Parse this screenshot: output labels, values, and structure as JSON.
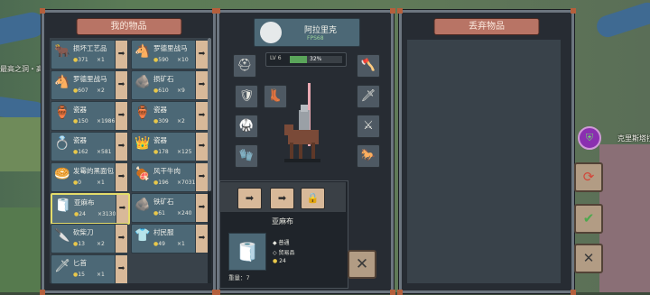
{
  "map": {
    "labels": {
      "left_town": "最高之洞・高村",
      "right_town": "克里斯塔拉"
    }
  },
  "left_panel": {
    "title": "我的物品",
    "items": [
      {
        "name": "损坏工艺品",
        "price": "371",
        "qty": "×1",
        "icon": "tools-icon",
        "glyph": "🐂"
      },
      {
        "name": "罗德里战马",
        "price": "590",
        "qty": "×10",
        "icon": "horse-icon",
        "glyph": "🐴"
      },
      {
        "name": "罗德里战马",
        "price": "607",
        "qty": "×2",
        "icon": "horse-icon",
        "glyph": "🐴"
      },
      {
        "name": "损矿石",
        "price": "610",
        "qty": "×9",
        "icon": "ore-icon",
        "glyph": "🪨"
      },
      {
        "name": "瓷器",
        "price": "150",
        "qty": "×1986",
        "icon": "pottery-icon",
        "glyph": "🏺"
      },
      {
        "name": "瓷器",
        "price": "309",
        "qty": "×2",
        "icon": "pottery-icon",
        "glyph": "🏺"
      },
      {
        "name": "瓷器",
        "price": "162",
        "qty": "×581",
        "icon": "jewelry-icon",
        "glyph": "💍"
      },
      {
        "name": "瓷器",
        "price": "178",
        "qty": "×125",
        "icon": "jewelry-icon",
        "glyph": "👑"
      },
      {
        "name": "发霉的黑面包",
        "price": "0",
        "qty": "×1",
        "icon": "bread-icon",
        "glyph": "🥯"
      },
      {
        "name": "风干牛肉",
        "price": "196",
        "qty": "×7031",
        "icon": "meat-icon",
        "glyph": "🍖"
      },
      {
        "name": "亚麻布",
        "price": "24",
        "qty": "×3130",
        "icon": "linen-icon",
        "glyph": "🧻",
        "selected": true
      },
      {
        "name": "铁矿石",
        "price": "61",
        "qty": "×240",
        "icon": "iron-ore-icon",
        "glyph": "🪨"
      },
      {
        "name": "砍柴刀",
        "price": "13",
        "qty": "×2",
        "icon": "machete-icon",
        "glyph": "🔪"
      },
      {
        "name": "村民服",
        "price": "49",
        "qty": "×1",
        "icon": "clothes-icon",
        "glyph": "👕"
      },
      {
        "name": "匕首",
        "price": "15",
        "qty": "×1",
        "icon": "dagger-icon",
        "glyph": "🗡"
      }
    ]
  },
  "character": {
    "name": "阿拉里克",
    "subtitle": "FPS68",
    "level_label": "LV 6",
    "xp_percent_text": "32%",
    "xp_fraction": 0.32
  },
  "selected_item": {
    "name": "亚麻布",
    "quality": "普通",
    "category": "贸易品",
    "price": "24",
    "weight_label": "重量：",
    "weight_value": "7"
  },
  "right_panel": {
    "title": "丢弃物品"
  },
  "colors": {
    "panel_bg": "#272c33",
    "slot_bg": "#4c6876",
    "button_tan": "#d8b999",
    "title_tab": "#b87465",
    "selected_border": "#e4dc6a",
    "xp_green": "#5aa55a",
    "coin": "#e9c84a"
  }
}
